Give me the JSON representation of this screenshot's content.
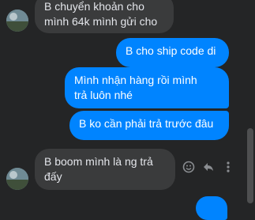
{
  "conversation": {
    "messages": [
      {
        "direction": "incoming",
        "text": "B chuyển khoản cho\nmình 64k mình gửi cho"
      },
      {
        "direction": "outgoing",
        "text": "B cho ship code di"
      },
      {
        "direction": "outgoing",
        "text": "Mình nhận hàng rồi mình\ntrả luôn nhé"
      },
      {
        "direction": "outgoing",
        "text": "B ko cần phải trả trước đâu"
      },
      {
        "direction": "incoming",
        "text": "B boom mình là ng trả\nđấy"
      }
    ]
  },
  "hover_actions": [
    "smiley-icon",
    "reply-icon",
    "more-icon"
  ],
  "colors": {
    "background": "#242526",
    "incoming_bubble": "#3a3b3c",
    "outgoing_bubble": "#0084ff",
    "incoming_text": "#e4e6eb",
    "outgoing_text": "#ffffff"
  }
}
